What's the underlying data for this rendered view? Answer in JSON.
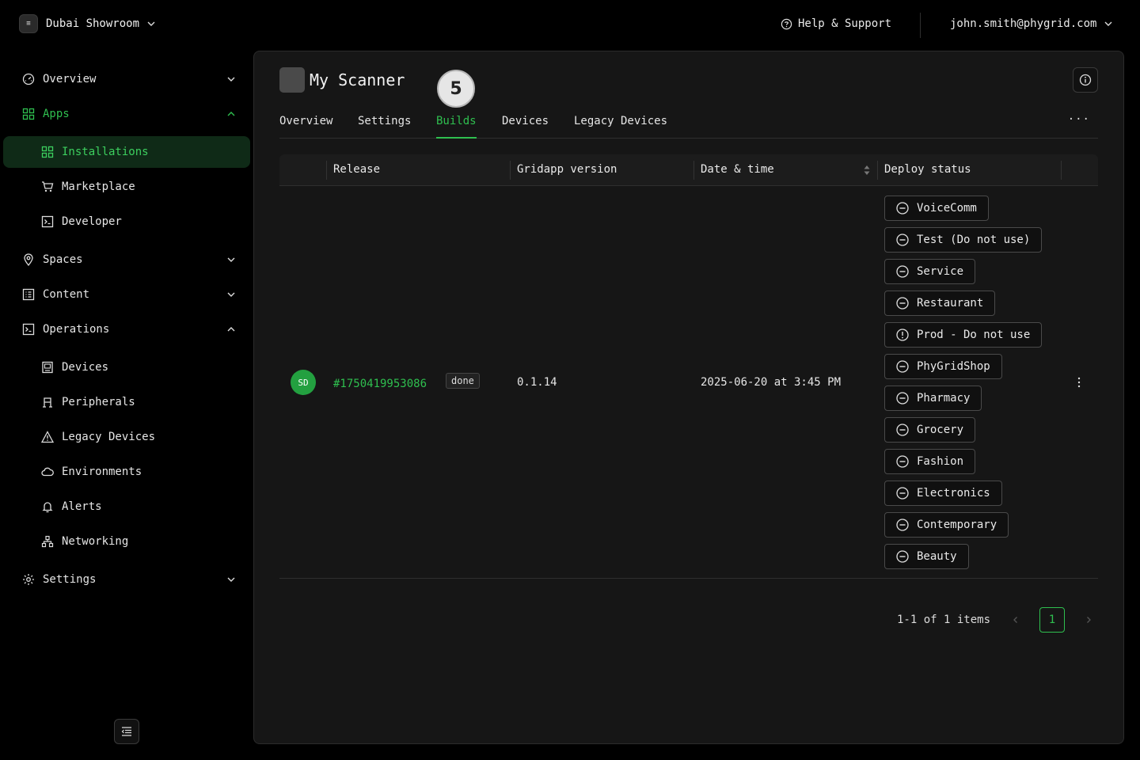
{
  "topbar": {
    "workspace_logo": "≡",
    "workspace_name": "Dubai Showroom",
    "help_label": "Help & Support",
    "user_email": "john.smith@phygrid.com"
  },
  "sidebar": {
    "overview": "Overview",
    "apps": "Apps",
    "installations": "Installations",
    "marketplace": "Marketplace",
    "developer": "Developer",
    "spaces": "Spaces",
    "content": "Content",
    "operations": "Operations",
    "devices": "Devices",
    "peripherals": "Peripherals",
    "legacy_devices": "Legacy Devices",
    "environments": "Environments",
    "alerts": "Alerts",
    "networking": "Networking",
    "settings": "Settings"
  },
  "app": {
    "title": "My Scanner",
    "step_number": "5",
    "tabs": [
      "Overview",
      "Settings",
      "Builds",
      "Devices",
      "Legacy Devices"
    ],
    "active_tab": "Builds",
    "more_label": "···"
  },
  "table": {
    "headers": [
      "Release",
      "Gridapp version",
      "Date & time",
      "Deploy status"
    ],
    "rows": [
      {
        "avatar": "SD",
        "release": "#1750419953086",
        "status": "done",
        "version": "0.1.14",
        "datetime": "2025-06-20 at 3:45 PM",
        "deploy": [
          {
            "name": "VoiceComm",
            "icon": "minus-circle-icon"
          },
          {
            "name": "Test (Do not use)",
            "icon": "minus-circle-icon"
          },
          {
            "name": "Service",
            "icon": "minus-circle-icon"
          },
          {
            "name": "Restaurant",
            "icon": "minus-circle-icon"
          },
          {
            "name": "Prod - Do not use",
            "icon": "alert-circle-icon"
          },
          {
            "name": "PhyGridShop",
            "icon": "minus-circle-icon"
          },
          {
            "name": "Pharmacy",
            "icon": "minus-circle-icon"
          },
          {
            "name": "Grocery",
            "icon": "minus-circle-icon"
          },
          {
            "name": "Fashion",
            "icon": "minus-circle-icon"
          },
          {
            "name": "Electronics",
            "icon": "minus-circle-icon"
          },
          {
            "name": "Contemporary",
            "icon": "minus-circle-icon"
          },
          {
            "name": "Beauty",
            "icon": "minus-circle-icon"
          }
        ]
      }
    ]
  },
  "pagination": {
    "summary": "1-1 of 1 items",
    "current_page": "1"
  },
  "colors": {
    "accent": "#2fbf4f",
    "active_bg": "#0f2a17",
    "panel_bg": "#161616",
    "page_bg": "#000000"
  }
}
